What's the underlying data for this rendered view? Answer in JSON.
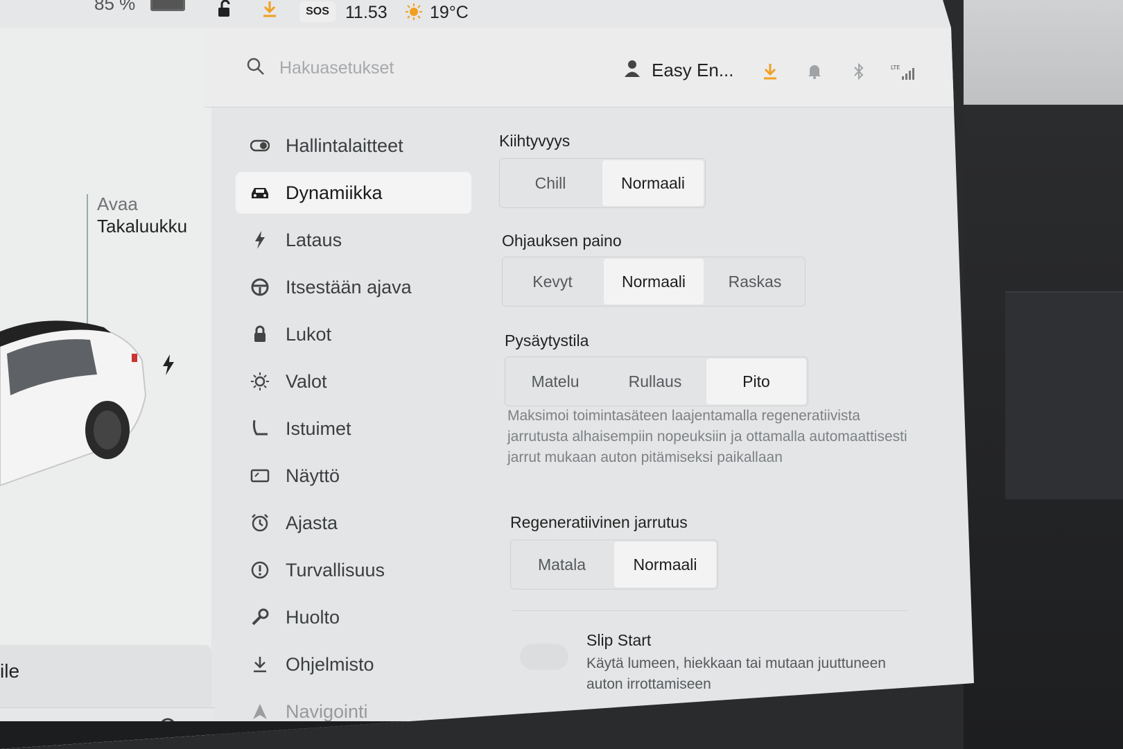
{
  "status_bar": {
    "battery_percent": "85 %",
    "sos_label": "SOS",
    "time": "11.53",
    "temperature": "19°C"
  },
  "car_panel": {
    "trunk_label_line1": "Avaa",
    "trunk_label_line2": "Takaluukku",
    "media_title": "ile"
  },
  "header": {
    "search_placeholder": "Hakuasetukset",
    "profile_name": "Easy En..."
  },
  "menu": {
    "items": [
      {
        "label": "Hallintalaitteet",
        "icon": "toggle-icon"
      },
      {
        "label": "Dynamiikka",
        "icon": "car-icon",
        "active": true
      },
      {
        "label": "Lataus",
        "icon": "bolt-icon"
      },
      {
        "label": "Itsestään ajava",
        "icon": "steering-wheel-icon"
      },
      {
        "label": "Lukot",
        "icon": "lock-icon"
      },
      {
        "label": "Valot",
        "icon": "light-icon"
      },
      {
        "label": "Istuimet",
        "icon": "seat-icon"
      },
      {
        "label": "Näyttö",
        "icon": "display-icon"
      },
      {
        "label": "Ajasta",
        "icon": "alarm-clock-icon"
      },
      {
        "label": "Turvallisuus",
        "icon": "alert-icon"
      },
      {
        "label": "Huolto",
        "icon": "wrench-icon"
      },
      {
        "label": "Ohjelmisto",
        "icon": "download-icon"
      },
      {
        "label": "Navigointi",
        "icon": "navigation-icon"
      }
    ]
  },
  "content": {
    "acceleration": {
      "title": "Kiihtyvyys",
      "options": [
        "Chill",
        "Normaali"
      ],
      "selected": "Normaali"
    },
    "steering": {
      "title": "Ohjauksen paino",
      "options": [
        "Kevyt",
        "Normaali",
        "Raskas"
      ],
      "selected": "Normaali"
    },
    "stopping": {
      "title": "Pysäytystila",
      "options": [
        "Matelu",
        "Rullaus",
        "Pito"
      ],
      "selected": "Pito",
      "description": "Maksimoi toimintasäteen laajentamalla regeneratiivista jarrutusta alhaisempiin nopeuksiin ja ottamalla automaattisesti jarrut mukaan auton pitämiseksi paikallaan"
    },
    "regen": {
      "title": "Regeneratiivinen jarrutus",
      "options": [
        "Matala",
        "Normaali"
      ],
      "selected": "Normaali"
    },
    "slip_start": {
      "title": "Slip Start",
      "description": "Käytä lumeen, hiekkaan tai mutaan juuttuneen auton irrottamiseen",
      "enabled": false
    }
  },
  "colors": {
    "accent_orange": "#f0a020",
    "screen_bg": "#e4e5e6",
    "selected_bg": "#f3f3f4"
  }
}
